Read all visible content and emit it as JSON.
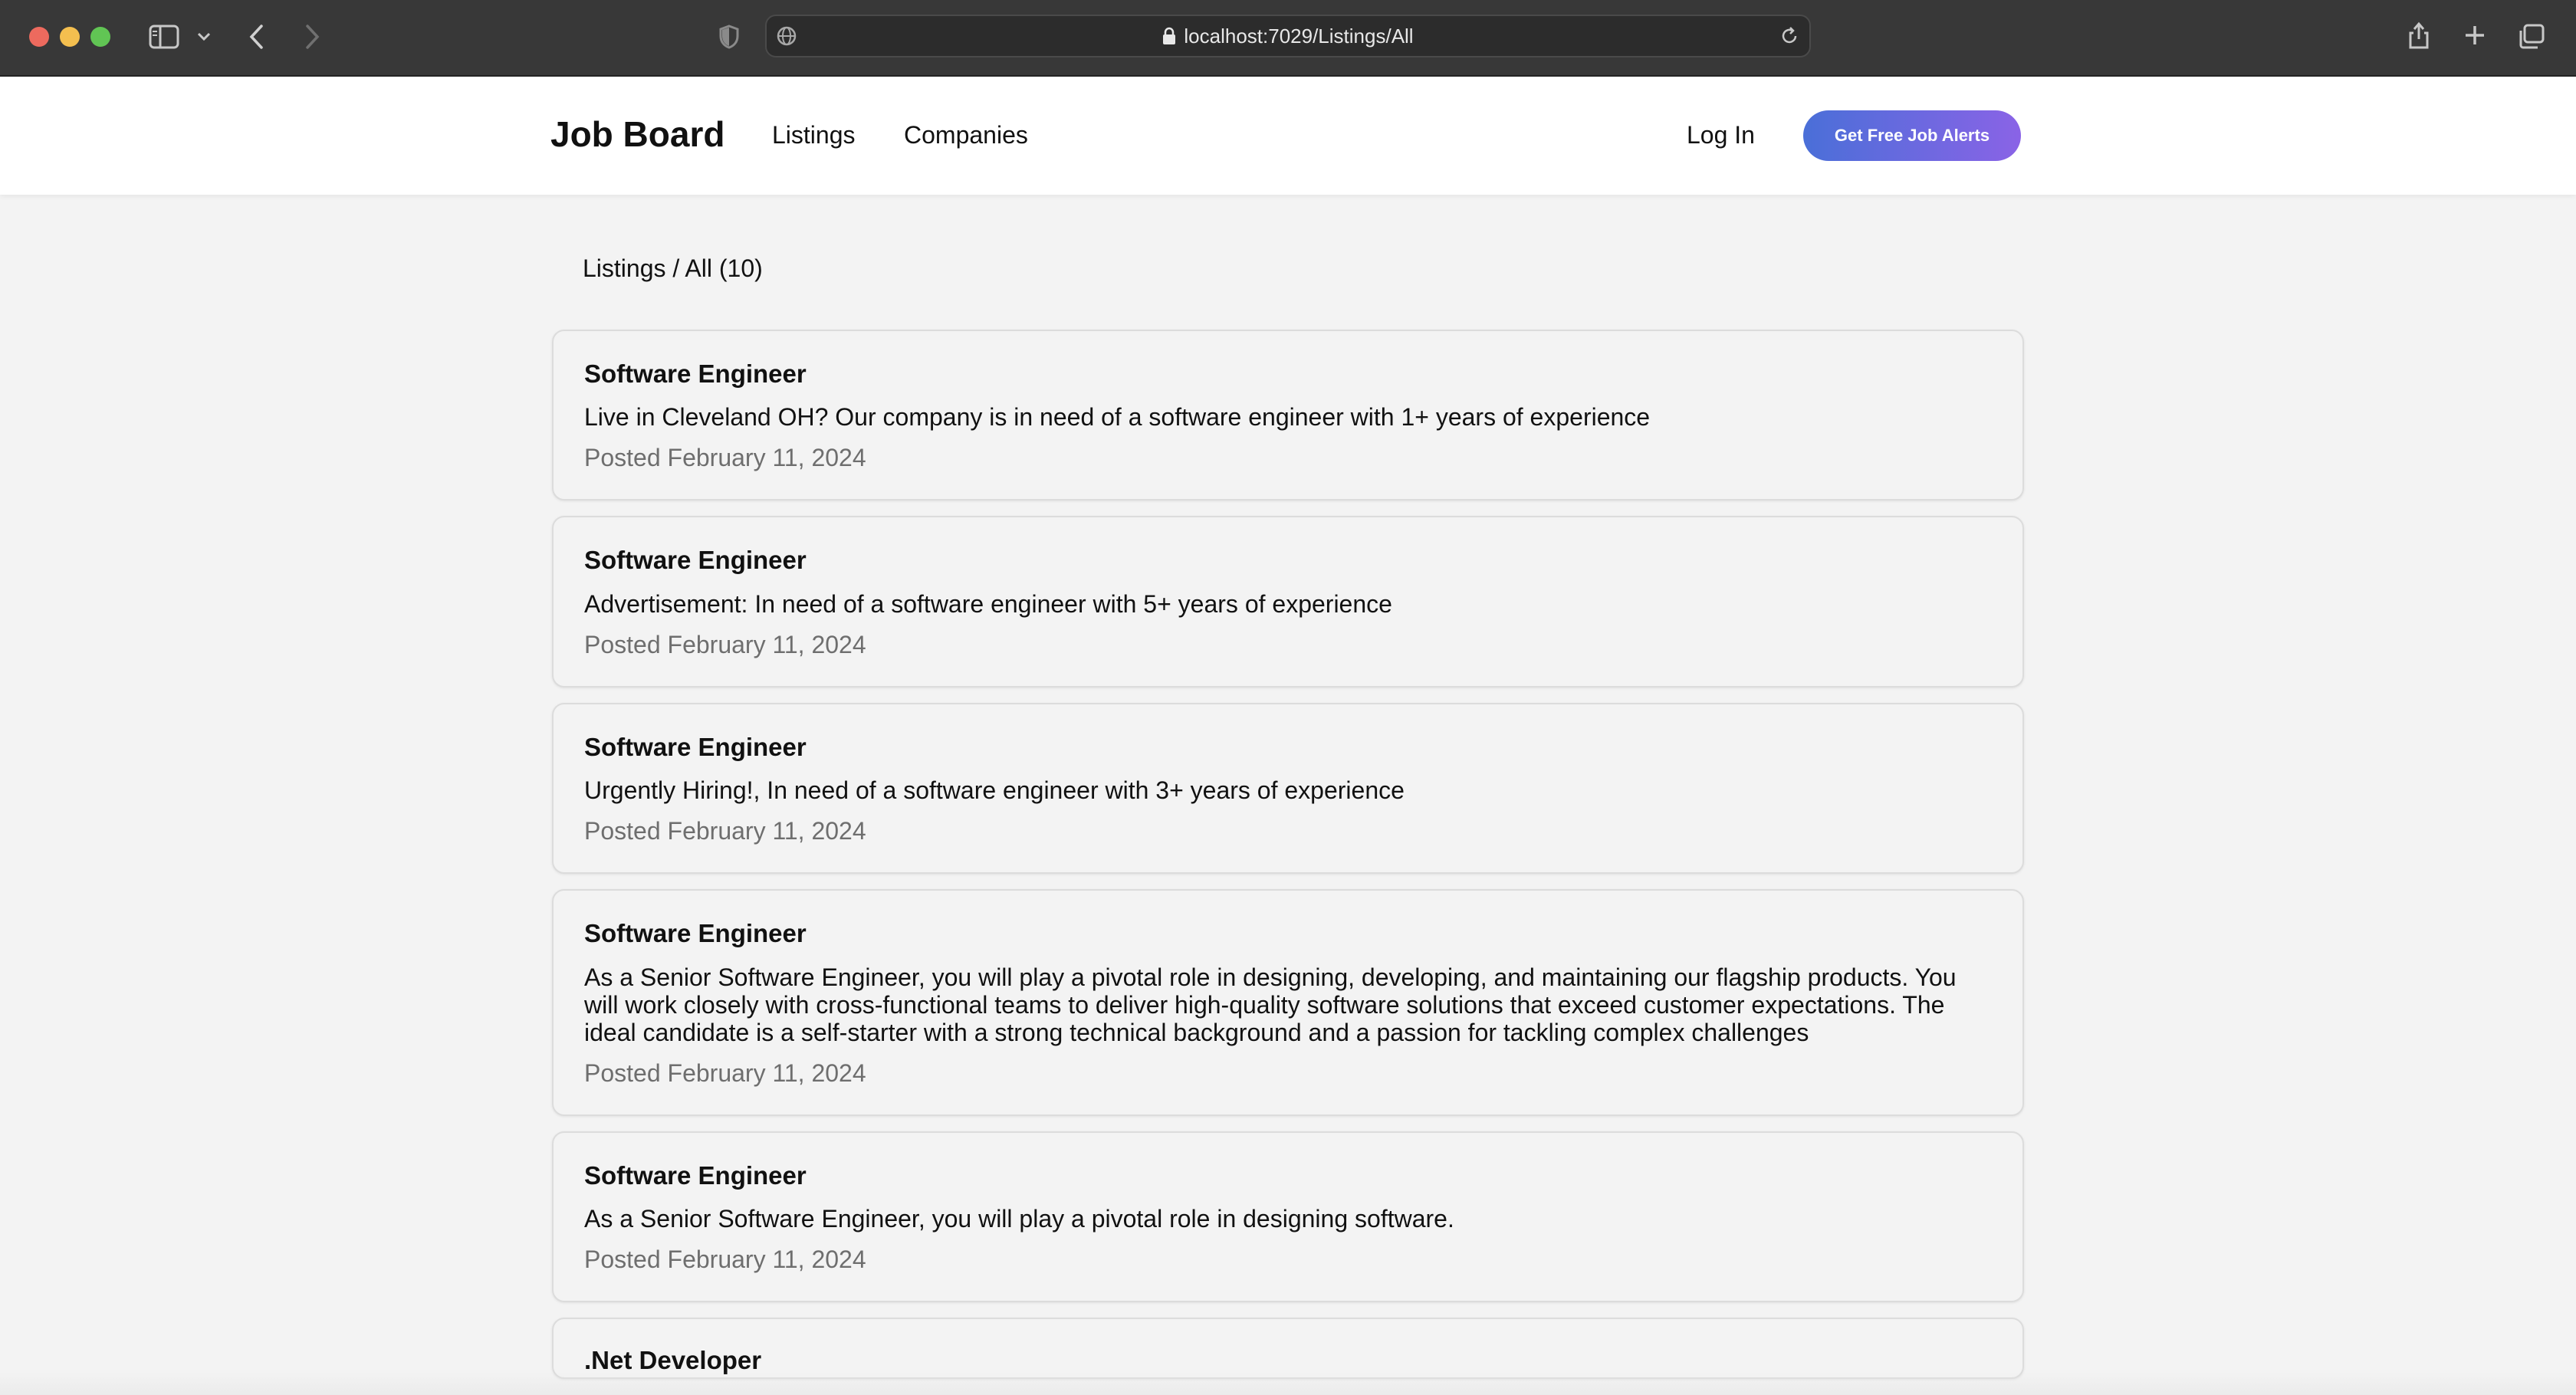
{
  "browser": {
    "url": "localhost:7029/Listings/All"
  },
  "header": {
    "brand": "Job Board",
    "nav": {
      "listings": "Listings",
      "companies": "Companies",
      "login": "Log In"
    },
    "cta_label": "Get Free Job Alerts"
  },
  "breadcrumb": "Listings / All (10)",
  "listings": [
    {
      "title": "Software Engineer",
      "description": "Live in Cleveland OH? Our company is in need of a software engineer with 1+ years of experience",
      "posted": "Posted February 11, 2024"
    },
    {
      "title": "Software Engineer",
      "description": "Advertisement: In need of a software engineer with 5+ years of experience",
      "posted": "Posted February 11, 2024"
    },
    {
      "title": "Software Engineer",
      "description": "Urgently Hiring!, In need of a software engineer with 3+ years of experience",
      "posted": "Posted February 11, 2024"
    },
    {
      "title": "Software Engineer",
      "description": "As a Senior Software Engineer, you will play a pivotal role in designing, developing, and maintaining our flagship products. You will work closely with cross-functional teams to deliver high-quality software solutions that exceed customer expectations. The ideal candidate is a self-starter with a strong technical background and a passion for tackling complex challenges",
      "posted": "Posted February 11, 2024"
    },
    {
      "title": "Software Engineer",
      "description": "As a Senior Software Engineer, you will play a pivotal role in designing software.",
      "posted": "Posted February 11, 2024"
    },
    {
      "title": ".Net Developer"
    }
  ],
  "colors": {
    "chrome_bg": "#383838",
    "page_bg": "#f3f3f3",
    "cta_start": "#4a6fd8",
    "cta_end": "#8a63e6",
    "date_text": "#6e6e6e"
  }
}
